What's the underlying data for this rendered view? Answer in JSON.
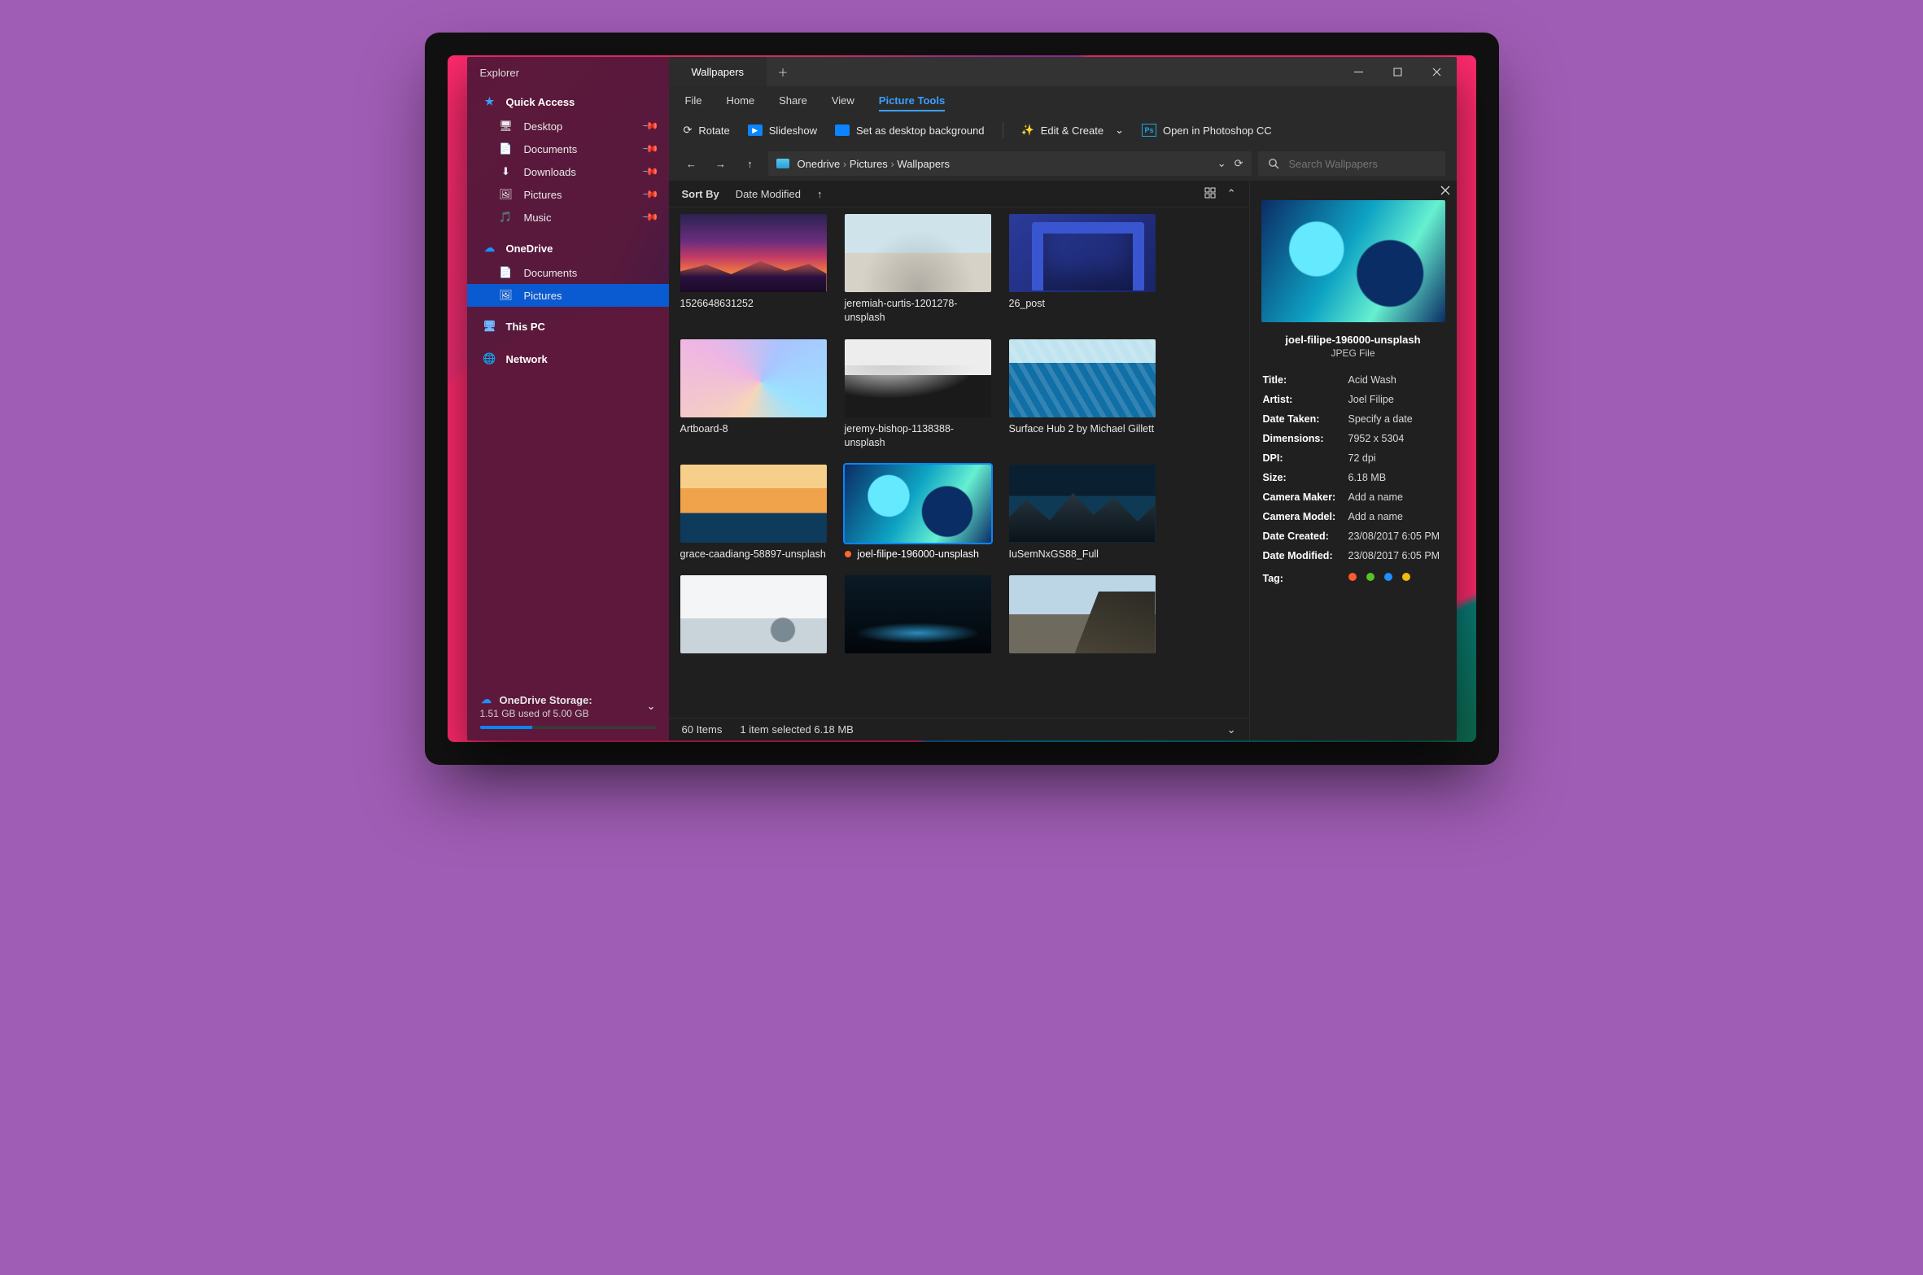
{
  "sidebar": {
    "title": "Explorer",
    "quick_access": {
      "label": "Quick Access",
      "items": [
        {
          "label": "Desktop"
        },
        {
          "label": "Documents"
        },
        {
          "label": "Downloads"
        },
        {
          "label": "Pictures"
        },
        {
          "label": "Music"
        }
      ]
    },
    "onedrive": {
      "label": "OneDrive",
      "items": [
        {
          "label": "Documents"
        },
        {
          "label": "Pictures"
        }
      ],
      "active_index": 1
    },
    "this_pc": {
      "label": "This PC"
    },
    "network": {
      "label": "Network"
    },
    "storage": {
      "label": "OneDrive Storage:",
      "detail": "1.51 GB used of 5.00 GB",
      "percent": 30
    }
  },
  "tabs": {
    "active": "Wallpapers"
  },
  "menubar": [
    "File",
    "Home",
    "Share",
    "View",
    "Picture Tools"
  ],
  "menubar_active_index": 4,
  "toolbar": {
    "rotate": "Rotate",
    "slideshow": "Slideshow",
    "set_bg": "Set as desktop background",
    "edit_create": "Edit & Create",
    "open_ps": "Open in Photoshop CC"
  },
  "breadcrumb": [
    "Onedrive",
    "Pictures",
    "Wallpapers"
  ],
  "search": {
    "placeholder": "Search Wallpapers"
  },
  "sort": {
    "label": "Sort By",
    "value": "Date Modified"
  },
  "files": [
    {
      "name": "1526648631252",
      "thumb": "t-sunset"
    },
    {
      "name": "jeremiah-curtis-1201278-unsplash",
      "thumb": "t-dunes"
    },
    {
      "name": "26_post",
      "thumb": "t-cube"
    },
    {
      "name": "Artboard-8",
      "thumb": "t-pastel"
    },
    {
      "name": "jeremy-bishop-1138388-unsplash",
      "thumb": "t-bwdune"
    },
    {
      "name": "Surface Hub 2 by Michael Gillett",
      "thumb": "t-waves"
    },
    {
      "name": "grace-caadiang-58897-unsplash",
      "thumb": "t-beach"
    },
    {
      "name": "joel-filipe-196000-unsplash",
      "thumb": "t-blueswirl",
      "selected": true
    },
    {
      "name": "IuSemNxGS88_Full",
      "thumb": "t-mtn"
    },
    {
      "name": "",
      "thumb": "t-snow"
    },
    {
      "name": "",
      "thumb": "t-darkwave"
    },
    {
      "name": "",
      "thumb": "t-cliff"
    }
  ],
  "status": {
    "count": "60 Items",
    "selection": "1 item selected 6.18 MB"
  },
  "details": {
    "name": "joel-filipe-196000-unsplash",
    "type": "JPEG File",
    "rows": [
      {
        "k": "Title:",
        "v": "Acid Wash"
      },
      {
        "k": "Artist:",
        "v": "Joel Filipe"
      },
      {
        "k": "Date Taken:",
        "v": "Specify a date"
      },
      {
        "k": "Dimensions:",
        "v": "7952 x 5304"
      },
      {
        "k": "DPI:",
        "v": "72 dpi"
      },
      {
        "k": "Size:",
        "v": "6.18 MB"
      },
      {
        "k": "Camera Maker:",
        "v": "Add a name"
      },
      {
        "k": "Camera Model:",
        "v": "Add a name"
      },
      {
        "k": "Date Created:",
        "v": "23/08/2017 6:05 PM"
      },
      {
        "k": "Date Modified:",
        "v": "23/08/2017 6:05 PM"
      }
    ],
    "tag_label": "Tag:",
    "tags": [
      "#ff5a2b",
      "#58c322",
      "#1e90ff",
      "#f2b90f"
    ]
  }
}
